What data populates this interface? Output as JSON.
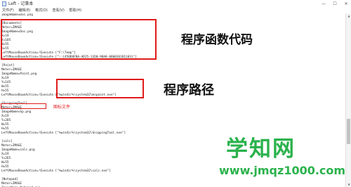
{
  "window": {
    "title": "Left - 记事本",
    "controls": [
      "—",
      "☐",
      "✕"
    ]
  },
  "menu": [
    "文件(F)",
    "编辑(E)",
    "格式(O)",
    "查看(V)",
    "帮助(H)"
  ],
  "code_lines": [
    "ImageName=Doc.png",
    "",
    "[Documents]",
    "Meter=IMAGE",
    "ImageName=Doc.png",
    "X=19",
    "Y=105",
    "W=55",
    "H=55",
    "LeftMouseDownAction=!Execute [\"F:\\Temp\"]",
    "LeftMouseDownAction=!Execute [\"::{450D8FBA-AD25-11D0-98A8-0800361B1103}\"]",
    "",
    "[Paint]",
    "Meter=IMAGE",
    "ImageName=Paint.png",
    "X=19",
    "Y=145",
    "W=55",
    "H=55",
    "LeftMouseDownAction=!Execute [\"%windir%\\system32\\mspaint.exe\"]",
    "",
    "[SnippingTool]",
    "Meter=IMAGE",
    "ImageName=Sp.png",
    "X=19",
    "Y=205",
    "W=55",
    "H=55",
    "LeftMouseDownAction=!Execute [\"%windir%\\system32\\SnippingTool.exe\"]",
    "",
    "[calc]",
    "Meter=IMAGE",
    "ImageName=calc.png",
    "X=19",
    "Y=265",
    "W=55",
    "H=55",
    "LeftMouseDownAction=!Execute [\"%windir%\\system32\\calc.exe\"]",
    "",
    "[Notepad]",
    "Meter=IMAGE",
    "ImageName=Notepad.png"
  ],
  "annotations": {
    "function_code": "程序函数代码",
    "program_path": "程序路径",
    "icon_file": "图标文件"
  },
  "watermark": {
    "logo": "学知网",
    "url": "www.jmqz1000.com"
  },
  "colors": {
    "highlight": "#e01b1b",
    "watermark": "#2bb24c"
  }
}
